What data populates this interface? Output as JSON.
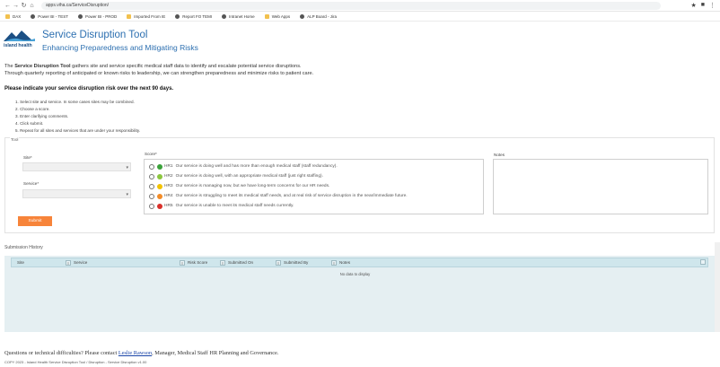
{
  "browser": {
    "url": "apps.viha.ca/ServiceDisruption/",
    "bookmarks": [
      "DAX",
      "Power BI - TEST",
      "Power BI - PROD",
      "Imported From IE",
      "Report FO TEMI",
      "Intranet Home",
      "Web Apps",
      "ALP Board - Jira"
    ]
  },
  "header": {
    "logo_text": "island health",
    "title": "Service Disruption Tool",
    "subtitle": "Enhancing Preparedness and Mitigating Risks"
  },
  "intro": {
    "lead": "The ",
    "tool_name": "Service Disruption Tool",
    "line1_rest": " gathers site and service specific medical staff data to identify and escalate potential service disruptions.",
    "line2": "Through quarterly reporting of anticipated or known risks to leadership, we can strengthen preparedness and minimize risks to patient care."
  },
  "prompt": "Please indicate your service disruption risk over the next 90 days.",
  "steps": [
    "1. Select site and service. In some cases sites may be combined.",
    "2. Choose a score.",
    "3. Enter clarifying comments.",
    "4. Click submit.",
    "5. Repeat for all sites and services that are under your responsibility."
  ],
  "form": {
    "legend": "Tool",
    "site_label": "Site*",
    "service_label": "Service*",
    "score_label": "Score*",
    "notes_label": "Notes",
    "submit_label": "Submit",
    "options": [
      {
        "code": "HR1",
        "text": "Our service is doing well and has more than enough medical staff (staff redundancy).",
        "color": "#3aa13a"
      },
      {
        "code": "HR2",
        "text": "Our service is doing well, with an appropriate medical staff (just right staffing).",
        "color": "#8cc63f"
      },
      {
        "code": "HR3",
        "text": "Our service is managing now, but we have long-term concerns for our HR needs.",
        "color": "#f2c200"
      },
      {
        "code": "HR4",
        "text": "Our service is struggling to meet its medical staff needs, and at real risk of service disruption in the near/immediate future.",
        "color": "#f28c28"
      },
      {
        "code": "HR5",
        "text": "Our service is unable to meet its medical staff needs currently.",
        "color": "#d9302a"
      }
    ]
  },
  "history": {
    "title": "Submission History",
    "columns": [
      "Site",
      "Service",
      "Risk Score",
      "Submitted On",
      "Submitted By",
      "Notes"
    ],
    "empty_text": "No data to display"
  },
  "footer": {
    "question": "Questions or technical difficulties? Please contact ",
    "contact_name": "Leslie Rawson",
    "contact_rest": ", Manager, Medical Staff HR Planning and Governance.",
    "copyright": "COPY 2023 - Island Health Service Disruption Tool / Disruption - Service Disruption v1.00"
  }
}
